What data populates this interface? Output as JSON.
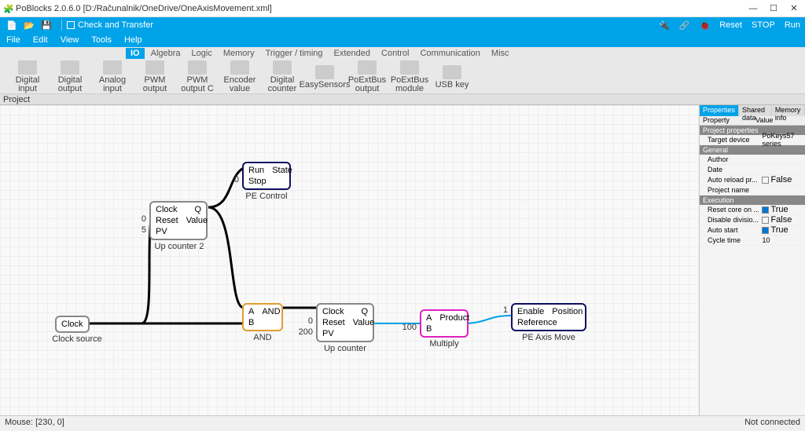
{
  "window": {
    "title": "PoBlocks 2.0.6.0 [D:/Računalnik/OneDrive/OneAxisMovement.xml]"
  },
  "qbar": {
    "check_label": "Check and Transfer",
    "reset": "Reset",
    "stop": "STOP",
    "run": "Run"
  },
  "menu": {
    "file": "File",
    "edit": "Edit",
    "view": "View",
    "tools": "Tools",
    "help": "Help"
  },
  "ribbon": {
    "tabs": [
      "IO",
      "Algebra",
      "Logic",
      "Memory",
      "Trigger / timing",
      "Extended",
      "Control",
      "Communication",
      "Misc"
    ],
    "active": 0,
    "items": [
      "Digital input",
      "Digital output",
      "Analog input",
      "PWM output",
      "PWM output C",
      "Encoder value",
      "Digital counter",
      "EasySensors",
      "PoExtBus output",
      "PoExtBus module",
      "USB key"
    ]
  },
  "project_label": "Project",
  "blocks": {
    "clocksrc": {
      "label": "Clock",
      "caption": "Clock source"
    },
    "upcounter2": {
      "p1": "Clock",
      "p1r": "Q",
      "p2": "Reset",
      "p2r": "Value",
      "p3": "PV",
      "reset_in": "0",
      "pv_in": "5",
      "caption": "Up counter 2"
    },
    "pecontrol": {
      "p1": "Run",
      "p1r": "State",
      "p2": "Stop",
      "stop_in": "0",
      "caption": "PE Control"
    },
    "and": {
      "a": "A",
      "ar": "AND",
      "b": "B",
      "caption": "AND"
    },
    "upcounter": {
      "p1": "Clock",
      "p1r": "Q",
      "p2": "Reset",
      "p2r": "Value",
      "p3": "PV",
      "reset_in": "0",
      "pv_in": "200",
      "caption": "Up counter"
    },
    "multiply": {
      "a": "A",
      "ar": "Product",
      "b": "B",
      "b_in": "100",
      "caption": "Multiply"
    },
    "peaxis": {
      "p1": "Enable",
      "p1r": "Position",
      "p2": "Reference",
      "enable_in": "1",
      "caption": "PE Axis Move"
    }
  },
  "properties": {
    "tabs": [
      "Properties",
      "Shared data",
      "Memory info"
    ],
    "head": [
      "Property",
      "Value"
    ],
    "sect1": "Project properties",
    "target_device_k": "Target device",
    "target_device_v": "PoKeys57 series",
    "sect2": "General",
    "author_k": "Author",
    "date_k": "Date",
    "auto_reload_k": "Auto reload pr...",
    "auto_reload_v": "False",
    "project_name_k": "Project name",
    "sect3": "Execution",
    "reset_core_k": "Reset core on ...",
    "reset_core_v": "True",
    "disable_div_k": "Disable divisio...",
    "disable_div_v": "False",
    "auto_start_k": "Auto start",
    "auto_start_v": "True",
    "cycle_time_k": "Cycle time",
    "cycle_time_v": "10"
  },
  "status": {
    "mouse": "Mouse: [230, 0]",
    "conn": "Not connected"
  }
}
